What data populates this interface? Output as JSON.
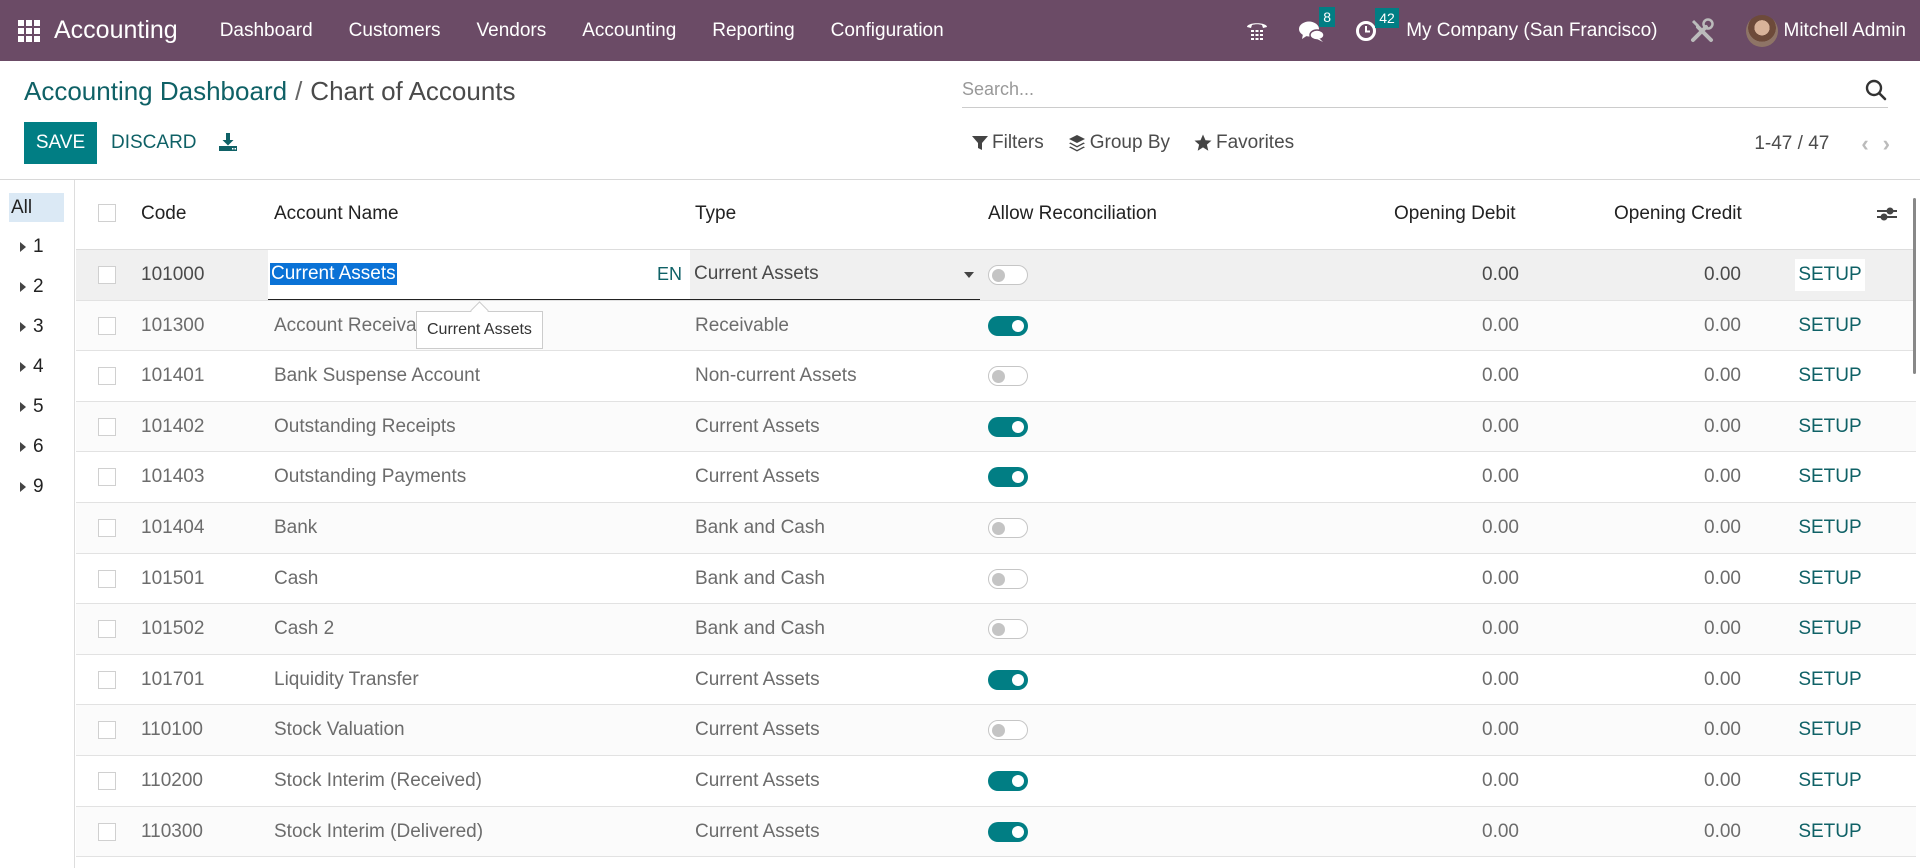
{
  "navbar": {
    "app_name": "Accounting",
    "menu": [
      "Dashboard",
      "Customers",
      "Vendors",
      "Accounting",
      "Reporting",
      "Configuration"
    ],
    "messages_count": "8",
    "activities_count": "42",
    "company": "My Company (San Francisco)",
    "user_name": "Mitchell Admin"
  },
  "breadcrumb": {
    "parent": "Accounting Dashboard",
    "separator": "/",
    "current": "Chart of Accounts"
  },
  "buttons": {
    "save": "SAVE",
    "discard": "DISCARD"
  },
  "search": {
    "placeholder": "Search..."
  },
  "filters": {
    "filters_label": "Filters",
    "group_by_label": "Group By",
    "favorites_label": "Favorites"
  },
  "pager": {
    "value": "1-47 / 47"
  },
  "side_panel": {
    "all_label": "All",
    "groups": [
      "1",
      "2",
      "3",
      "4",
      "5",
      "6",
      "9"
    ]
  },
  "table": {
    "columns": {
      "code": "Code",
      "name": "Account Name",
      "type": "Type",
      "reconcile": "Allow Reconciliation",
      "debit": "Opening Debit",
      "credit": "Opening Credit"
    },
    "setup_label": "SETUP",
    "editing": {
      "lang": "EN",
      "tooltip": "Current Assets"
    },
    "rows": [
      {
        "code": "101000",
        "name": "Current Assets",
        "type": "Current Assets",
        "reconcile": false,
        "debit": "0.00",
        "credit": "0.00"
      },
      {
        "code": "101300",
        "name": "Account Receivable",
        "type": "Receivable",
        "reconcile": true,
        "debit": "0.00",
        "credit": "0.00"
      },
      {
        "code": "101401",
        "name": "Bank Suspense Account",
        "type": "Non-current Assets",
        "reconcile": false,
        "debit": "0.00",
        "credit": "0.00"
      },
      {
        "code": "101402",
        "name": "Outstanding Receipts",
        "type": "Current Assets",
        "reconcile": true,
        "debit": "0.00",
        "credit": "0.00"
      },
      {
        "code": "101403",
        "name": "Outstanding Payments",
        "type": "Current Assets",
        "reconcile": true,
        "debit": "0.00",
        "credit": "0.00"
      },
      {
        "code": "101404",
        "name": "Bank",
        "type": "Bank and Cash",
        "reconcile": false,
        "debit": "0.00",
        "credit": "0.00"
      },
      {
        "code": "101501",
        "name": "Cash",
        "type": "Bank and Cash",
        "reconcile": false,
        "debit": "0.00",
        "credit": "0.00"
      },
      {
        "code": "101502",
        "name": "Cash 2",
        "type": "Bank and Cash",
        "reconcile": false,
        "debit": "0.00",
        "credit": "0.00"
      },
      {
        "code": "101701",
        "name": "Liquidity Transfer",
        "type": "Current Assets",
        "reconcile": true,
        "debit": "0.00",
        "credit": "0.00"
      },
      {
        "code": "110100",
        "name": "Stock Valuation",
        "type": "Current Assets",
        "reconcile": false,
        "debit": "0.00",
        "credit": "0.00"
      },
      {
        "code": "110200",
        "name": "Stock Interim (Received)",
        "type": "Current Assets",
        "reconcile": true,
        "debit": "0.00",
        "credit": "0.00"
      },
      {
        "code": "110300",
        "name": "Stock Interim (Delivered)",
        "type": "Current Assets",
        "reconcile": true,
        "debit": "0.00",
        "credit": "0.00"
      }
    ]
  },
  "colors": {
    "navbar": "#6b4b66",
    "primary": "#017e84",
    "link": "#0f6166"
  }
}
